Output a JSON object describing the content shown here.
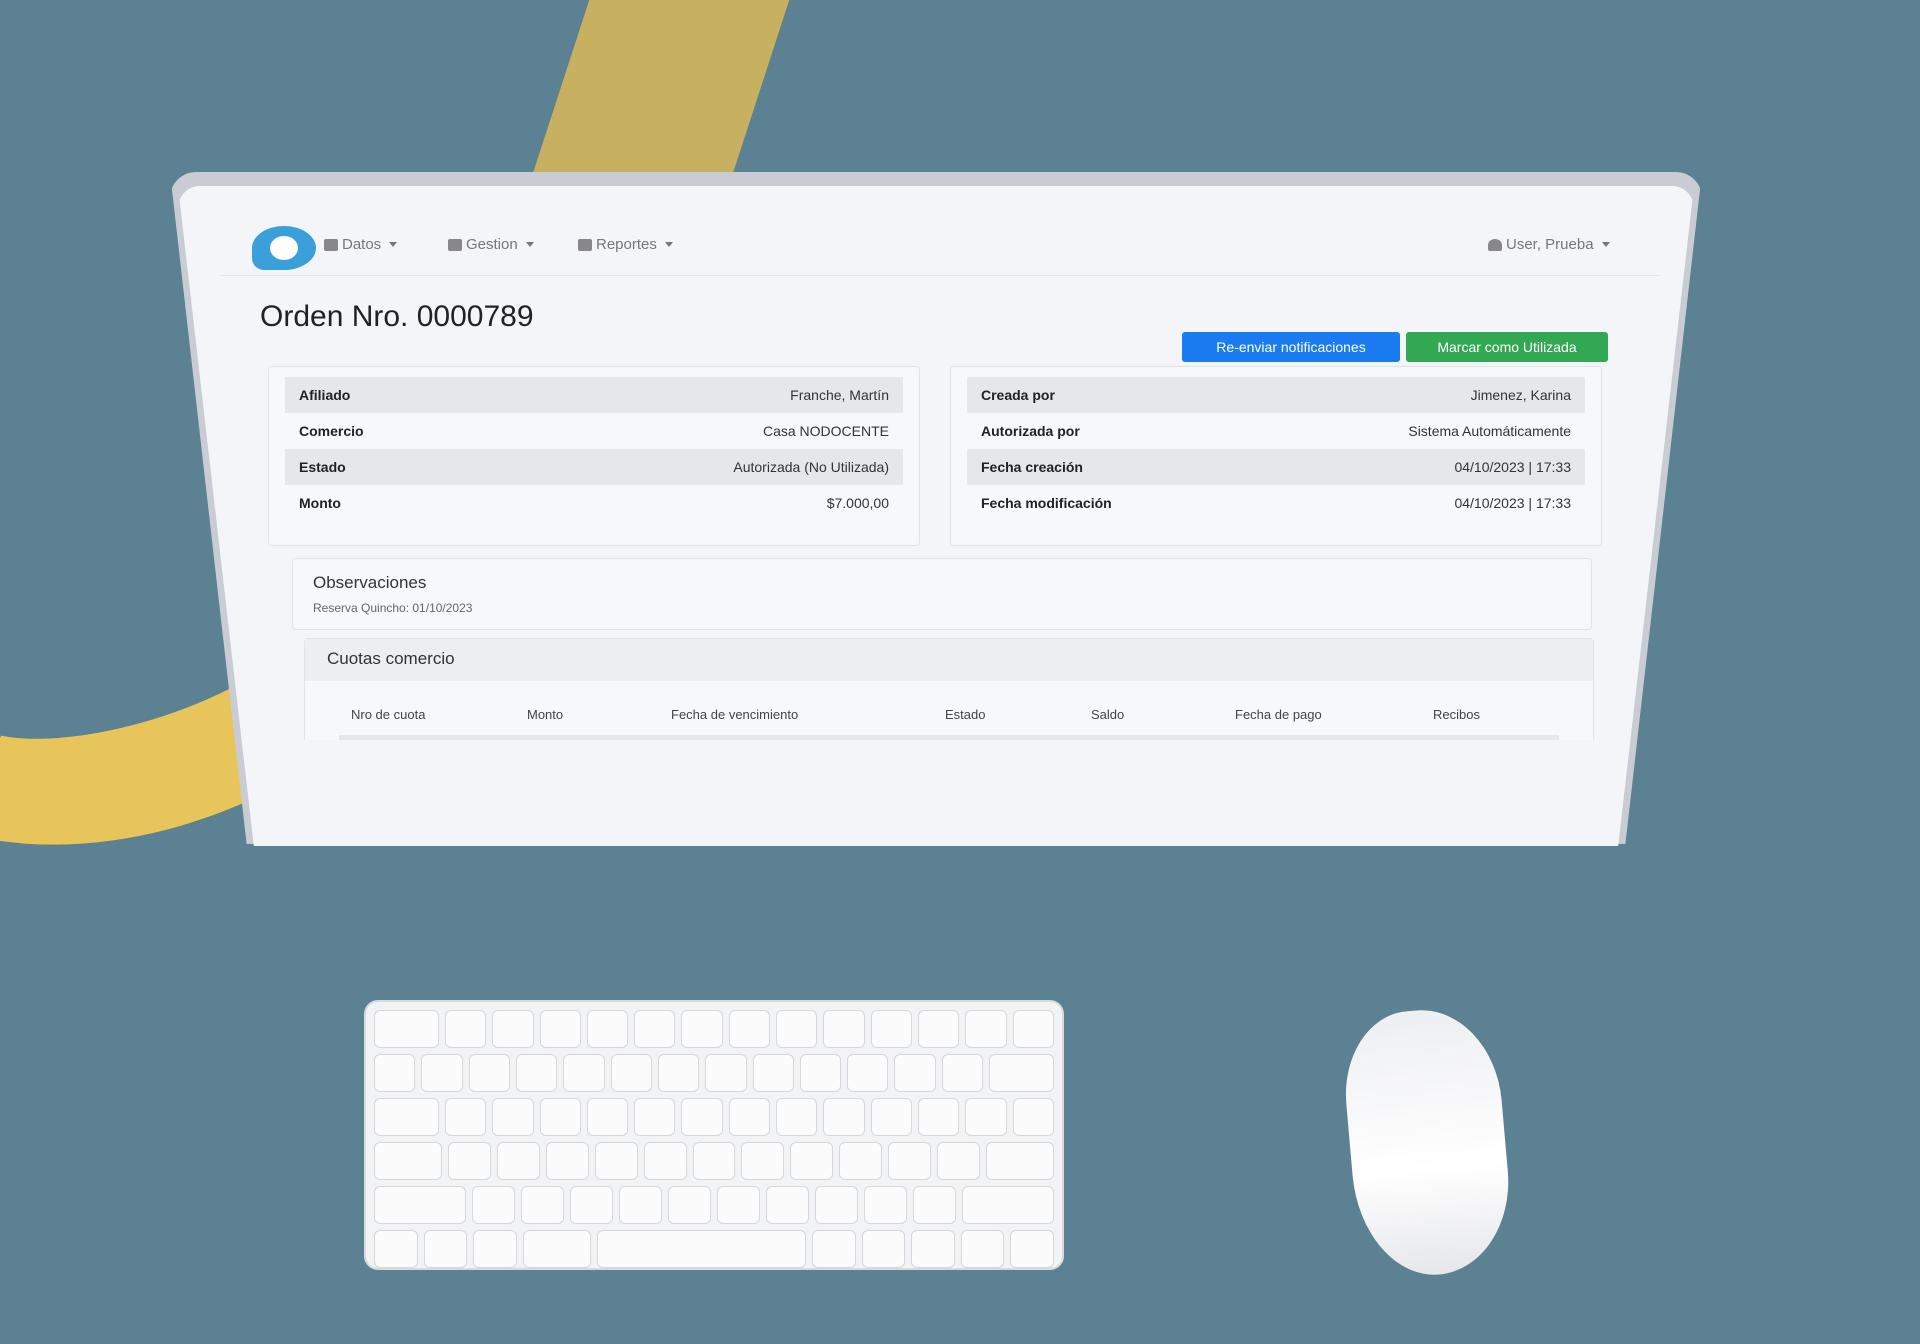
{
  "nav": {
    "datos": "Datos",
    "gestion": "Gestion",
    "reportes": "Reportes",
    "user": "User, Prueba"
  },
  "order": {
    "title": "Orden Nro. 0000789"
  },
  "actions": {
    "resend": "Re-enviar notificaciones",
    "mark_used": "Marcar como Utilizada"
  },
  "details_left": [
    {
      "label": "Afiliado",
      "value": "Franche, Martín"
    },
    {
      "label": "Comercio",
      "value": "Casa NODOCENTE"
    },
    {
      "label": "Estado",
      "value": "Autorizada (No Utilizada)"
    },
    {
      "label": "Monto",
      "value": "$7.000,00"
    }
  ],
  "details_right": [
    {
      "label": "Creada por",
      "value": "Jimenez, Karina"
    },
    {
      "label": "Autorizada por",
      "value": "Sistema Automáticamente"
    },
    {
      "label": "Fecha creación",
      "value": "04/10/2023 | 17:33"
    },
    {
      "label": "Fecha modificación",
      "value": "04/10/2023 | 17:33"
    }
  ],
  "observaciones": {
    "title": "Observaciones",
    "text": "Reserva Quincho: 01/10/2023"
  },
  "cuotas": {
    "title": "Cuotas comercio",
    "columns": [
      "Nro de cuota",
      "Monto",
      "Fecha de vencimiento",
      "Estado",
      "Saldo",
      "Fecha de pago",
      "Recibos"
    ]
  },
  "colors": {
    "background": "#5b8193",
    "accent_yellow": "#e8c55a",
    "button_blue": "#1a7cf0",
    "button_green": "#33a852",
    "logo_blue": "#3b9fd9"
  },
  "icons": [
    "users-icon",
    "table-icon",
    "report-icon",
    "user-icon",
    "caret-down-icon"
  ]
}
